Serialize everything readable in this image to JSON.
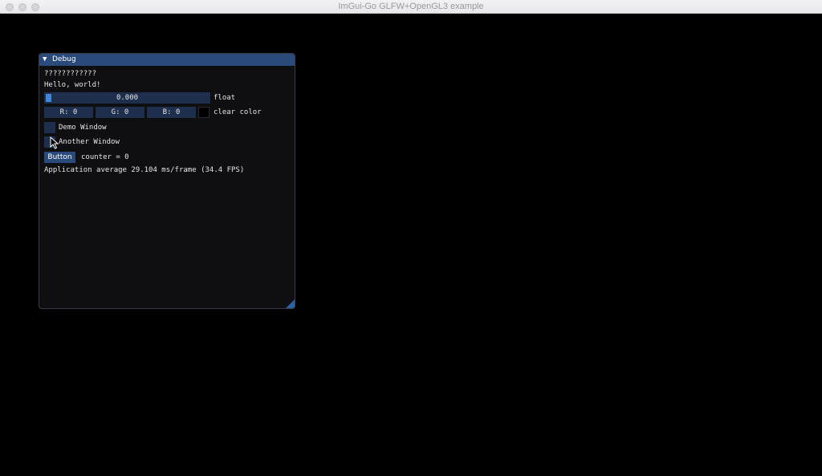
{
  "os_window": {
    "title": "ImGui-Go GLFW+OpenGL3 example"
  },
  "debug_window": {
    "title": "Debug",
    "collapse_arrow": "▼",
    "text_line": "????????????",
    "hello_text": "Hello, world!",
    "slider": {
      "value_text": "0.000",
      "value": 0,
      "label": "float"
    },
    "color_edit": {
      "r_text": "R:  0",
      "g_text": "G:  0",
      "b_text": "B:  0",
      "label": "clear color",
      "swatch_color": "#000000"
    },
    "checkboxes": [
      {
        "label": "Demo Window",
        "checked": false
      },
      {
        "label": "Another Window",
        "checked": false
      }
    ],
    "button_label": "Button",
    "counter_text": "counter = 0",
    "fps_text": "Application average 29.104 ms/frame (34.4 FPS)"
  },
  "colors": {
    "accent": "#294a7a",
    "frame_bg": "#1d2f4c",
    "grab": "#3d85e0",
    "window_bg": "#0f0f12"
  }
}
